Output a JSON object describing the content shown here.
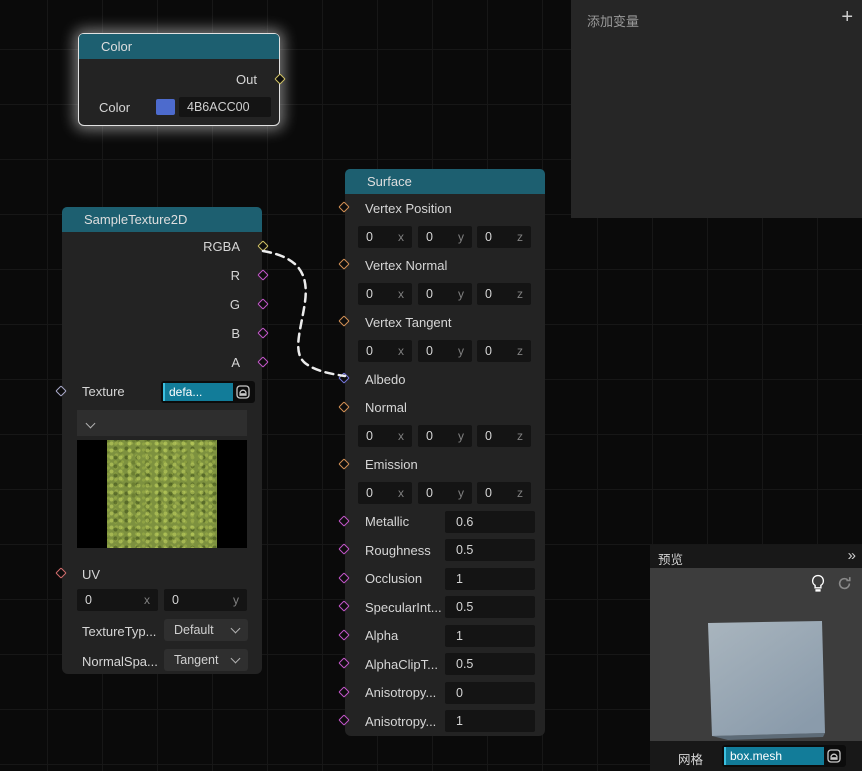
{
  "port_colors": {
    "yellow": "#cdbf63",
    "magenta": "#c255c8",
    "orange": "#d18f55",
    "blue": "#7577de",
    "grey": "#a8a8c8",
    "red": "#d06c6c"
  },
  "colors": {
    "node_header_teal": "#1d5f70",
    "asset_highlight_teal": "#127c99",
    "swatch_blue": "#4d6bcd",
    "wire": "#ececec",
    "cube_light": "#a9b5be",
    "cube_dark": "#8a9bab"
  },
  "variables_panel": {
    "title": "添加变量",
    "add_button": "+"
  },
  "nodes": {
    "color": {
      "title": "Color",
      "output": {
        "label": "Out",
        "port": "yellow"
      },
      "input": {
        "label": "Color",
        "hex": "4B6ACC00",
        "swatch_color": "#4d6bcd"
      }
    },
    "sample_texture": {
      "title": "SampleTexture2D",
      "outputs": [
        {
          "label": "RGBA",
          "port": "yellow"
        },
        {
          "label": "R",
          "port": "magenta"
        },
        {
          "label": "G",
          "port": "magenta"
        },
        {
          "label": "B",
          "port": "magenta"
        },
        {
          "label": "A",
          "port": "magenta"
        }
      ],
      "texture": {
        "label": "Texture",
        "value": "defa...",
        "port": "grey",
        "icon": "asset-slot-icon"
      },
      "thumbnail": "grass-texture",
      "uv": {
        "label": "UV",
        "port": "red",
        "x": "0",
        "x_suffix": "x",
        "y": "0",
        "y_suffix": "y"
      },
      "dropdowns": [
        {
          "label": "TextureTyp...",
          "value": "Default"
        },
        {
          "label": "NormalSpa...",
          "value": "Tangent"
        }
      ]
    },
    "surface": {
      "title": "Surface",
      "vec_suffixes": [
        "x",
        "y",
        "z"
      ],
      "rows": [
        {
          "kind": "label",
          "label": "Vertex Position",
          "port": "orange"
        },
        {
          "kind": "vec3",
          "x": "0",
          "y": "0",
          "z": "0"
        },
        {
          "kind": "label",
          "label": "Vertex Normal",
          "port": "orange"
        },
        {
          "kind": "vec3",
          "x": "0",
          "y": "0",
          "z": "0"
        },
        {
          "kind": "label",
          "label": "Vertex Tangent",
          "port": "orange"
        },
        {
          "kind": "vec3",
          "x": "0",
          "y": "0",
          "z": "0"
        },
        {
          "kind": "label",
          "label": "Albedo",
          "port": "blue",
          "connected": true
        },
        {
          "kind": "label",
          "label": "Normal",
          "port": "orange"
        },
        {
          "kind": "vec3",
          "x": "0",
          "y": "0",
          "z": "0"
        },
        {
          "kind": "label",
          "label": "Emission",
          "port": "orange"
        },
        {
          "kind": "vec3",
          "x": "0",
          "y": "0",
          "z": "0"
        },
        {
          "kind": "scalar",
          "label": "Metallic",
          "port": "magenta",
          "value": "0.6"
        },
        {
          "kind": "scalar",
          "label": "Roughness",
          "port": "magenta",
          "value": "0.5"
        },
        {
          "kind": "scalar",
          "label": "Occlusion",
          "port": "magenta",
          "value": "1"
        },
        {
          "kind": "scalar",
          "label": "SpecularInt...",
          "port": "magenta",
          "value": "0.5"
        },
        {
          "kind": "scalar",
          "label": "Alpha",
          "port": "magenta",
          "value": "1"
        },
        {
          "kind": "scalar",
          "label": "AlphaClipT...",
          "port": "magenta",
          "value": "0.5"
        },
        {
          "kind": "scalar",
          "label": "Anisotropy...",
          "port": "magenta",
          "value": "0"
        },
        {
          "kind": "scalar",
          "label": "Anisotropy...",
          "port": "magenta",
          "value": "1"
        }
      ]
    }
  },
  "connection": {
    "from": "SampleTexture2D.RGBA",
    "to": "Surface.Albedo",
    "style": "dashed"
  },
  "preview_panel": {
    "title": "预览",
    "collapse_icon": "»",
    "light_icon": "lightbulb-icon",
    "refresh_icon": "refresh-icon",
    "mesh_label": "网格",
    "mesh_value": "box.mesh"
  }
}
